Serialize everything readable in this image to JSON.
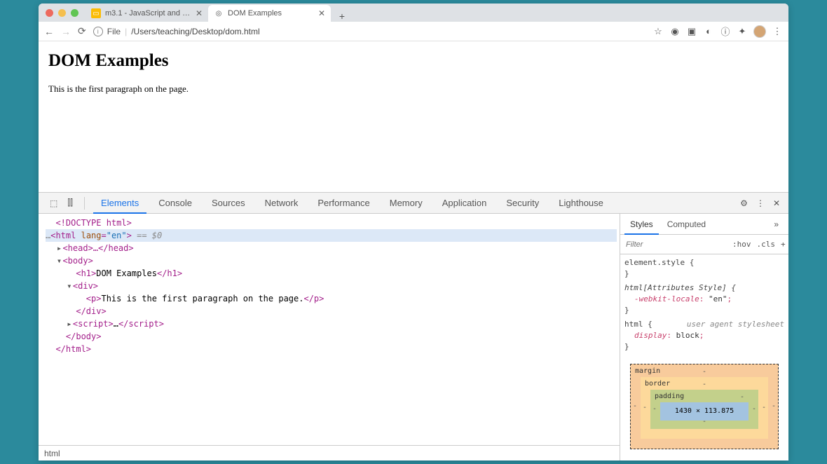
{
  "tabs": [
    {
      "title": "m3.1 - JavaScript and the DOM",
      "active": false
    },
    {
      "title": "DOM Examples",
      "active": true
    }
  ],
  "address": {
    "scheme": "File",
    "path": "/Users/teaching/Desktop/dom.html"
  },
  "page": {
    "heading": "DOM Examples",
    "paragraph": "This is the first paragraph on the page."
  },
  "devtools": {
    "tabs": [
      "Elements",
      "Console",
      "Sources",
      "Network",
      "Performance",
      "Memory",
      "Application",
      "Security",
      "Lighthouse"
    ],
    "activeTab": "Elements",
    "dom": {
      "doctype": "<!DOCTYPE html>",
      "html_open_prefix": "<html ",
      "html_attr_name": "lang",
      "html_attr_eq": "=",
      "html_attr_val": "\"en\"",
      "html_open_suffix": ">",
      "sel_marker": " == $0",
      "head": "<head>…</head>",
      "body_open": "<body>",
      "h1_open": "<h1>",
      "h1_text": "DOM Examples",
      "h1_close": "</h1>",
      "div_open": "<div>",
      "p_open": "<p>",
      "p_text": "This is the first paragraph on the page.",
      "p_close": "</p>",
      "div_close": "</div>",
      "script_open": "<script>",
      "script_mid": "…",
      "script_close": "</script>",
      "body_close": "</body>",
      "html_close": "</html>"
    },
    "breadcrumb": "html",
    "styles": {
      "tabs": [
        "Styles",
        "Computed"
      ],
      "filter_placeholder": "Filter",
      "hov": ":hov",
      "cls": ".cls",
      "rules": {
        "r1_sel": "element.style {",
        "r1_close": "}",
        "r2_sel": "html[Attributes Style] {",
        "r2_prop": "-webkit-locale",
        "r2_val": "\"en\"",
        "r2_end": ";",
        "r2_close": "}",
        "r3_sel": "html {",
        "r3_ua": "user agent stylesheet",
        "r3_prop": "display",
        "r3_val": "block",
        "r3_end": ";",
        "r3_close": "}"
      },
      "box_model": {
        "margin_label": "margin",
        "margin_val": "-",
        "border_label": "border",
        "border_val": "-",
        "padding_label": "padding",
        "padding_val": "-",
        "content": "1430 × 113.875",
        "side_dash": "-"
      }
    }
  }
}
